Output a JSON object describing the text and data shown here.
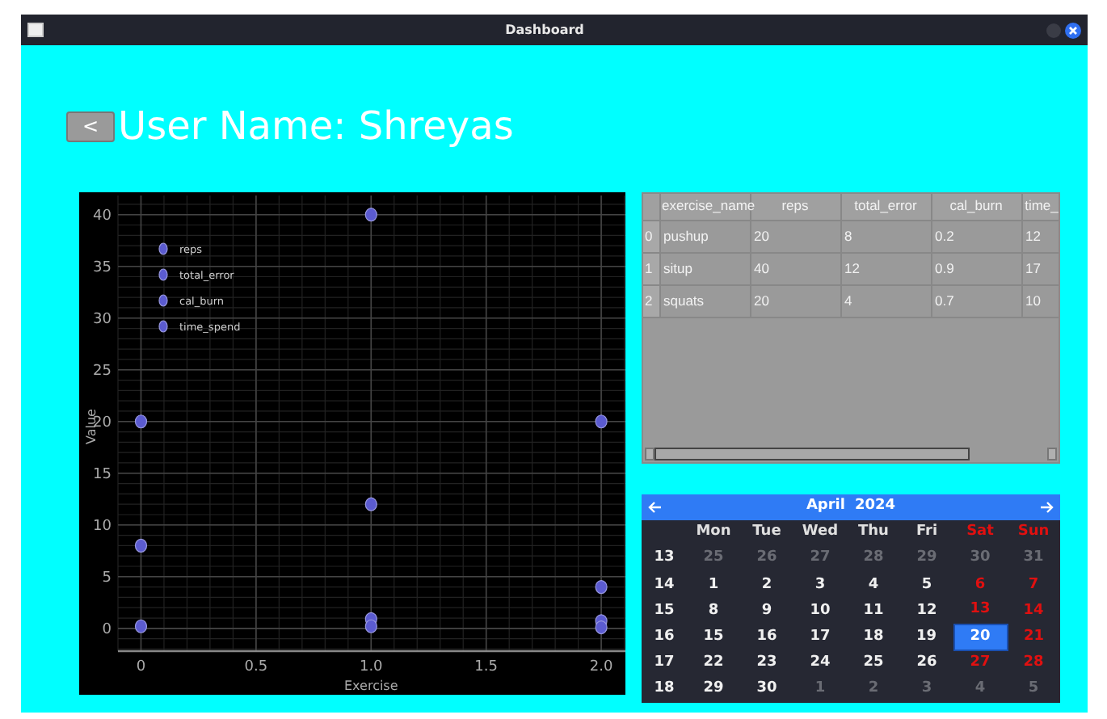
{
  "window": {
    "title": "Dashboard"
  },
  "header": {
    "back_button": "<",
    "title": "User Name: Shreyas"
  },
  "chart": {
    "chart_data": {
      "type": "scatter",
      "xlabel": "Exercise",
      "ylabel": "Value",
      "x": [
        0,
        1,
        2
      ],
      "series": [
        {
          "name": "reps",
          "color": "#5b5bd0",
          "values": [
            20,
            40,
            20
          ]
        },
        {
          "name": "total_error",
          "color": "#5b5bd0",
          "values": [
            8,
            12,
            4
          ]
        },
        {
          "name": "cal_burn",
          "color": "#5b5bd0",
          "values": [
            0.2,
            0.9,
            0.7
          ]
        },
        {
          "name": "time_spend",
          "color": "#5b5bd0",
          "values": [
            null,
            0.2,
            0.1
          ]
        }
      ],
      "xlim": [
        -0.1,
        2.105
      ],
      "ylim": [
        -2.2,
        41.85
      ],
      "grid": true,
      "legend": true,
      "xticks": [
        {
          "value": 0,
          "label": "0"
        },
        {
          "value": 0.5,
          "label": "0.5"
        },
        {
          "value": 1,
          "label": "1.0"
        },
        {
          "value": 1.5,
          "label": "1.5"
        },
        {
          "value": 2,
          "label": "2.0"
        }
      ],
      "yticks": [
        0,
        5,
        10,
        15,
        20,
        25,
        30,
        35,
        40
      ]
    }
  },
  "table": {
    "columns": [
      "exercise_name",
      "reps",
      "total_error",
      "cal_burn",
      "time_"
    ],
    "rows": [
      {
        "index": "0",
        "cells": [
          "pushup",
          "20",
          "8",
          "0.2",
          "12"
        ]
      },
      {
        "index": "1",
        "cells": [
          "situp",
          "40",
          "12",
          "0.9",
          "17"
        ]
      },
      {
        "index": "2",
        "cells": [
          "squats",
          "20",
          "4",
          "0.7",
          "10"
        ]
      }
    ]
  },
  "calendar": {
    "month": "April",
    "year": "2024",
    "weekdays": [
      "Mon",
      "Tue",
      "Wed",
      "Thu",
      "Fri",
      "Sat",
      "Sun"
    ],
    "weeks": [
      {
        "number": "13",
        "days": [
          {
            "day": "25",
            "in_month": false,
            "selected": false
          },
          {
            "day": "26",
            "in_month": false,
            "selected": false
          },
          {
            "day": "27",
            "in_month": false,
            "selected": false
          },
          {
            "day": "28",
            "in_month": false,
            "selected": false
          },
          {
            "day": "29",
            "in_month": false,
            "selected": false
          },
          {
            "day": "30",
            "in_month": false,
            "selected": false
          },
          {
            "day": "31",
            "in_month": false,
            "selected": false
          }
        ]
      },
      {
        "number": "14",
        "days": [
          {
            "day": "1",
            "in_month": true,
            "selected": false
          },
          {
            "day": "2",
            "in_month": true,
            "selected": false
          },
          {
            "day": "3",
            "in_month": true,
            "selected": false
          },
          {
            "day": "4",
            "in_month": true,
            "selected": false
          },
          {
            "day": "5",
            "in_month": true,
            "selected": false
          },
          {
            "day": "6",
            "in_month": true,
            "selected": false
          },
          {
            "day": "7",
            "in_month": true,
            "selected": false
          }
        ]
      },
      {
        "number": "15",
        "days": [
          {
            "day": "8",
            "in_month": true,
            "selected": false
          },
          {
            "day": "9",
            "in_month": true,
            "selected": false
          },
          {
            "day": "10",
            "in_month": true,
            "selected": false
          },
          {
            "day": "11",
            "in_month": true,
            "selected": false
          },
          {
            "day": "12",
            "in_month": true,
            "selected": false
          },
          {
            "day": "13",
            "in_month": true,
            "selected": false
          },
          {
            "day": "14",
            "in_month": true,
            "selected": false
          }
        ]
      },
      {
        "number": "16",
        "days": [
          {
            "day": "15",
            "in_month": true,
            "selected": false
          },
          {
            "day": "16",
            "in_month": true,
            "selected": false
          },
          {
            "day": "17",
            "in_month": true,
            "selected": false
          },
          {
            "day": "18",
            "in_month": true,
            "selected": false
          },
          {
            "day": "19",
            "in_month": true,
            "selected": false
          },
          {
            "day": "20",
            "in_month": true,
            "selected": true
          },
          {
            "day": "21",
            "in_month": true,
            "selected": false
          }
        ]
      },
      {
        "number": "17",
        "days": [
          {
            "day": "22",
            "in_month": true,
            "selected": false
          },
          {
            "day": "23",
            "in_month": true,
            "selected": false
          },
          {
            "day": "24",
            "in_month": true,
            "selected": false
          },
          {
            "day": "25",
            "in_month": true,
            "selected": false
          },
          {
            "day": "26",
            "in_month": true,
            "selected": false
          },
          {
            "day": "27",
            "in_month": true,
            "selected": false
          },
          {
            "day": "28",
            "in_month": true,
            "selected": false
          }
        ]
      },
      {
        "number": "18",
        "days": [
          {
            "day": "29",
            "in_month": true,
            "selected": false
          },
          {
            "day": "30",
            "in_month": true,
            "selected": false
          },
          {
            "day": "1",
            "in_month": false,
            "selected": false
          },
          {
            "day": "2",
            "in_month": false,
            "selected": false
          },
          {
            "day": "3",
            "in_month": false,
            "selected": false
          },
          {
            "day": "4",
            "in_month": false,
            "selected": false
          },
          {
            "day": "5",
            "in_month": false,
            "selected": false
          }
        ]
      }
    ]
  }
}
